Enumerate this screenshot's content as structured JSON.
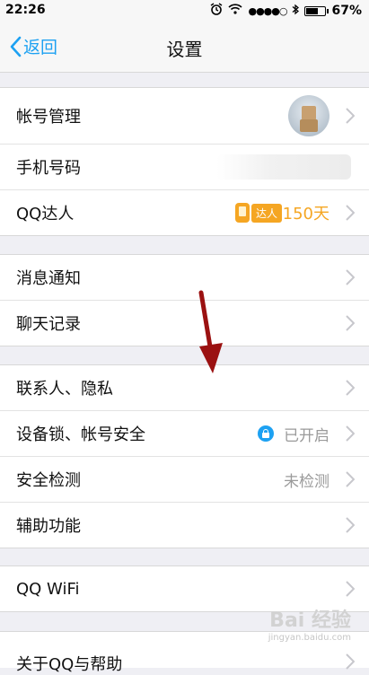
{
  "status_bar": {
    "time": "22:26",
    "signal": "●●●●○",
    "battery_text": "67%",
    "battery_level": 0.67
  },
  "nav": {
    "back_label": "返回",
    "title": "设置"
  },
  "groups": {
    "account": {
      "account_manage": "帐号管理",
      "phone_number": "手机号码",
      "qq_daren": "QQ达人",
      "daren_badge": "达人",
      "daren_days": "150天"
    },
    "notify": {
      "message_notify": "消息通知",
      "chat_history": "聊天记录"
    },
    "privacy": {
      "contacts_privacy": "联系人、隐私",
      "device_lock": "设备锁、帐号安全",
      "device_lock_status": "已开启",
      "security_check": "安全检测",
      "security_check_status": "未检测",
      "accessibility": "辅助功能"
    },
    "wifi": {
      "qq_wifi": "QQ WiFi"
    },
    "about": {
      "about_help": "关于QQ与帮助"
    }
  },
  "watermark": {
    "main": "Bai 经验",
    "sub": "jingyan.baidu.com"
  },
  "colors": {
    "accent": "#1da1f2",
    "daren": "#f5a623",
    "arrow": "#9b1111"
  }
}
